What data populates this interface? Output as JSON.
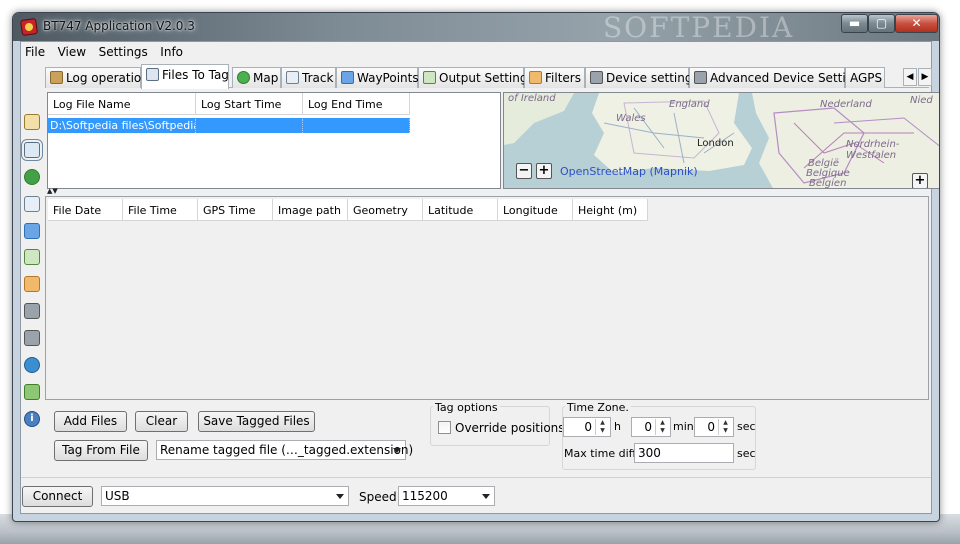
{
  "window": {
    "title": "BT747 Application V2.0.3",
    "watermark": "SOFTPEDIA",
    "controls": {
      "minimize": "▬",
      "maximize": "▢",
      "close": "✕"
    }
  },
  "menu": [
    "File",
    "View",
    "Settings",
    "Info"
  ],
  "tabs": [
    {
      "label": "Log operations",
      "icon": "disk-icon"
    },
    {
      "label": "Files To Tag",
      "icon": "copy-files-icon",
      "active": true
    },
    {
      "label": "Map",
      "icon": "globe-icon"
    },
    {
      "label": "Track",
      "icon": "track-icon"
    },
    {
      "label": "WayPoints",
      "icon": "waypoint-icon"
    },
    {
      "label": "Output Settings",
      "icon": "output-icon"
    },
    {
      "label": "Filters",
      "icon": "funnel-icon"
    },
    {
      "label": "Device settings",
      "icon": "wrench-icon"
    },
    {
      "label": "Advanced Device Settings",
      "icon": "wrench-plus-icon"
    },
    {
      "label": "AGPS",
      "icon": ""
    }
  ],
  "sidebar_icons": [
    "home-icon",
    "copy-files-icon",
    "globe-icon",
    "track-icon",
    "waypoint-icon",
    "output-icon",
    "funnel-icon",
    "wrench-icon",
    "wrench-plus-icon",
    "agps-globe-icon",
    "export-icon",
    "info-icon"
  ],
  "log_table": {
    "columns": [
      "Log File Name",
      "Log Start Time",
      "Log End Time"
    ],
    "rows": [
      [
        "D:\\Softpedia files\\Softpedia…",
        "",
        ""
      ]
    ]
  },
  "map": {
    "labels": [
      "of Ireland",
      "England",
      "Wales",
      "London",
      "Nederland",
      "Nordrhein-Westfalen",
      "België",
      "Belgique",
      "Belgien",
      "Nied"
    ],
    "attribution": "OpenStreetMap (Mapnik)",
    "zoom_out": "−",
    "zoom_in": "+",
    "expand": "+"
  },
  "file_table": {
    "columns": [
      "File Date",
      "File Time",
      "GPS Time",
      "Image path",
      "Geometry",
      "Latitude",
      "Longitude",
      "Height (m)"
    ]
  },
  "actions": {
    "add_files": "Add Files",
    "clear": "Clear",
    "save_tagged": "Save Tagged Files",
    "tag_from_file": "Tag From File",
    "rename_option": "Rename tagged file (…_tagged.extension)"
  },
  "tag_options": {
    "title": "Tag options",
    "override_positions": "Override positions",
    "override_checked": false
  },
  "time_zone": {
    "title": "Time Zone.",
    "hours": "0",
    "hours_unit": "h",
    "minutes": "0",
    "minutes_unit": "min",
    "seconds": "0",
    "seconds_unit": "sec",
    "max_diff_label": "Max time diff:",
    "max_diff": "300",
    "max_diff_unit": "sec"
  },
  "status": {
    "connect": "Connect",
    "port": "USB",
    "speed_label": "Speed:",
    "speed": "115200"
  }
}
